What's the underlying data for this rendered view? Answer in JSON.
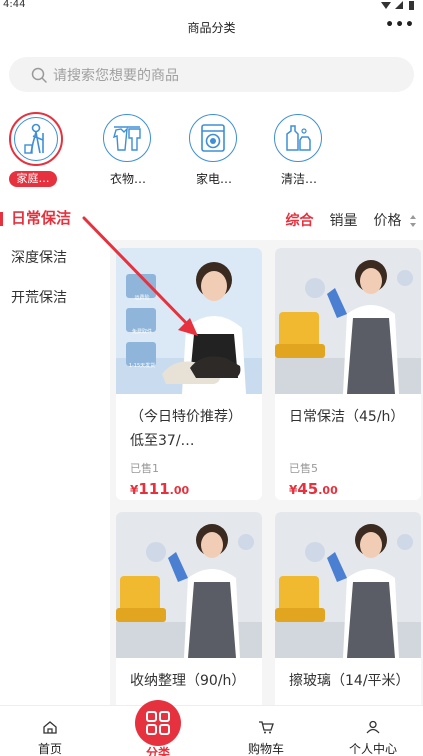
{
  "status_bar": {
    "time": "4:44"
  },
  "header": {
    "title": "商品分类",
    "more_icon": "more-dots-icon",
    "more_label": "•••"
  },
  "search": {
    "placeholder": "请搜索您想要的商品",
    "icon": "search-icon"
  },
  "categories": [
    {
      "label": "家庭…",
      "icon": "cleaning-person-icon",
      "active": true
    },
    {
      "label": "衣物…",
      "icon": "clothes-icon",
      "active": false
    },
    {
      "label": "家电…",
      "icon": "washing-machine-icon",
      "active": false
    },
    {
      "label": "清洁…",
      "icon": "cleaning-bottles-icon",
      "active": false
    }
  ],
  "sidebar": {
    "items": [
      {
        "label": "日常保洁",
        "active": true
      },
      {
        "label": "深度保洁",
        "active": false
      },
      {
        "label": "开荒保洁",
        "active": false
      }
    ]
  },
  "sort": {
    "items": [
      {
        "label": "综合",
        "active": true
      },
      {
        "label": "销量",
        "active": false
      },
      {
        "label": "价格",
        "active": false
      }
    ]
  },
  "products": [
    {
      "title": "（今日特价推荐）低至37/…",
      "sold": "已售1",
      "price_symbol": "¥",
      "price_int": "111",
      "price_dec": ".00",
      "image": "shoes-promo-image",
      "badges": [
        "运费险",
        "免费取件",
        "1-15天发货"
      ]
    },
    {
      "title": "日常保洁（45/h）",
      "sold": "已售5",
      "price_symbol": "¥",
      "price_int": "45",
      "price_dec": ".00",
      "image": "cleaner-photo-image"
    },
    {
      "title": "收纳整理（90/h）",
      "image": "cleaner-photo-image"
    },
    {
      "title": "擦玻璃（14/平米）",
      "image": "cleaner-photo-image"
    }
  ],
  "tabbar": {
    "items": [
      {
        "label": "首页",
        "icon": "home-icon",
        "active": false
      },
      {
        "label": "分类",
        "icon": "category-grid-icon",
        "active": true
      },
      {
        "label": "购物车",
        "icon": "cart-icon",
        "active": false
      },
      {
        "label": "个人中心",
        "icon": "user-icon",
        "active": false
      }
    ]
  },
  "colors": {
    "accent": "#e5323e",
    "icon_blue": "#3d8fd6",
    "product_bg": "#f5f5f5"
  }
}
